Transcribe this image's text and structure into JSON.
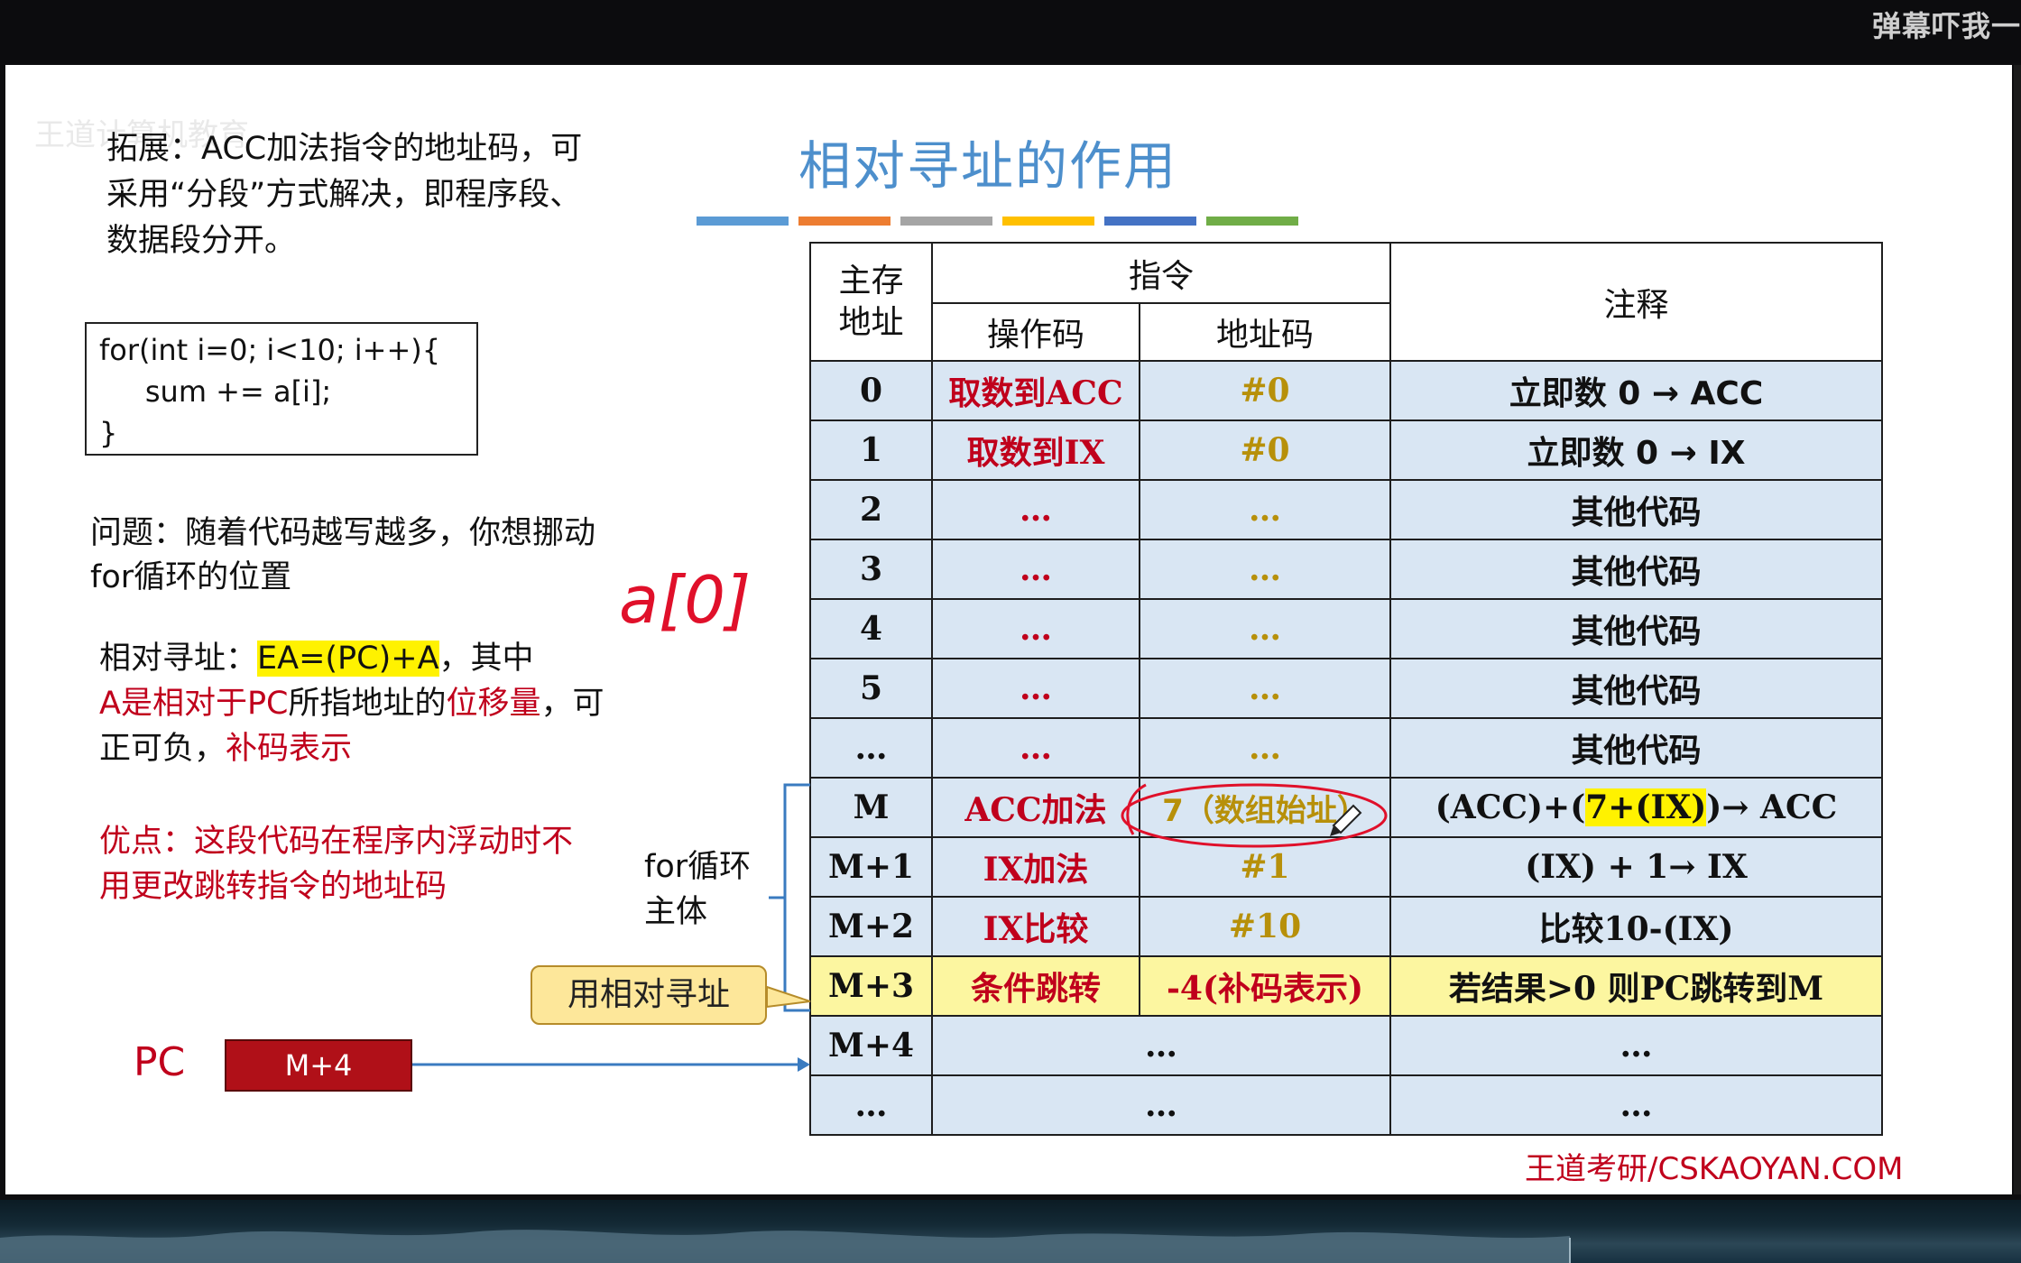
{
  "overlay": {
    "danmaku": "弹幕吓我一"
  },
  "slide": {
    "watermark": "王道计算机教育",
    "left": {
      "extension": "拓展：ACC加法指令的地址码，可采用“分段”方式解决，即程序段、数据段分开。",
      "code_lines": [
        "for(int i=0; i<10; i++){",
        "     sum += a[i];",
        "}"
      ],
      "question": "问题：随着代码越写越多，你想挪动for循环的位置",
      "rel_prefix": "相对寻址：",
      "rel_formula": "EA=(PC)+A",
      "rel_after": "，其中",
      "rel_a": "A是相对于PC",
      "rel_mid": "所指地址的",
      "rel_disp": "位移量",
      "rel_comma": "，可正可负，",
      "rel_comp": "补码表示",
      "advantage": "优点：这段代码在程序内浮动时不用更改跳转指令的地址码",
      "for_body": "for循环主体",
      "callout": "用相对寻址",
      "pc_label": "PC",
      "pc_value": "M+4",
      "handwriting": "a[0]"
    },
    "title": "相对寻址的作用",
    "bar_colors": [
      "#5b9bd5",
      "#ed7d31",
      "#a5a5a5",
      "#ffc000",
      "#4472c4",
      "#70ad47"
    ],
    "table": {
      "h_addr": "主存地址",
      "h_instr": "指令",
      "h_opcode": "操作码",
      "h_addrcode": "地址码",
      "h_note": "注释",
      "rows": [
        {
          "addr": "0",
          "op": "取数到ACC",
          "ac": "#0",
          "note": "立即数 0 → ACC"
        },
        {
          "addr": "1",
          "op": "取数到IX",
          "ac": "#0",
          "note": "立即数 0 → IX"
        },
        {
          "addr": "2",
          "op": "…",
          "ac": "…",
          "note": "其他代码"
        },
        {
          "addr": "3",
          "op": "…",
          "ac": "…",
          "note": "其他代码"
        },
        {
          "addr": "4",
          "op": "…",
          "ac": "…",
          "note": "其他代码"
        },
        {
          "addr": "5",
          "op": "…",
          "ac": "…",
          "note": "其他代码"
        },
        {
          "addr": "…",
          "op": "…",
          "ac": "…",
          "note": "其他代码"
        }
      ],
      "rowM": {
        "addr": "M",
        "op": "ACC加法",
        "ac": "7（数组始址）",
        "note_a": "(ACC)+(",
        "note_b": "7+(IX)",
        "note_c": ")→ ACC"
      },
      "rowM1": {
        "addr": "M+1",
        "op": "IX加法",
        "ac": "#1",
        "note": "(IX) + 1→ IX"
      },
      "rowM2": {
        "addr": "M+2",
        "op": "IX比较",
        "ac": "#10",
        "note": "比较10-(IX)"
      },
      "rowM3": {
        "addr": "M+3",
        "op": "条件跳转",
        "ac": "-4(补码表示)",
        "note": "若结果>0 则PC跳转到M"
      },
      "rowM4": {
        "addr": "M+4",
        "instr": "…",
        "note": "…"
      },
      "rowLast": {
        "addr": "…",
        "instr": "…",
        "note": "…"
      }
    },
    "footer": "王道考研/CSKAOYAN.COM"
  }
}
